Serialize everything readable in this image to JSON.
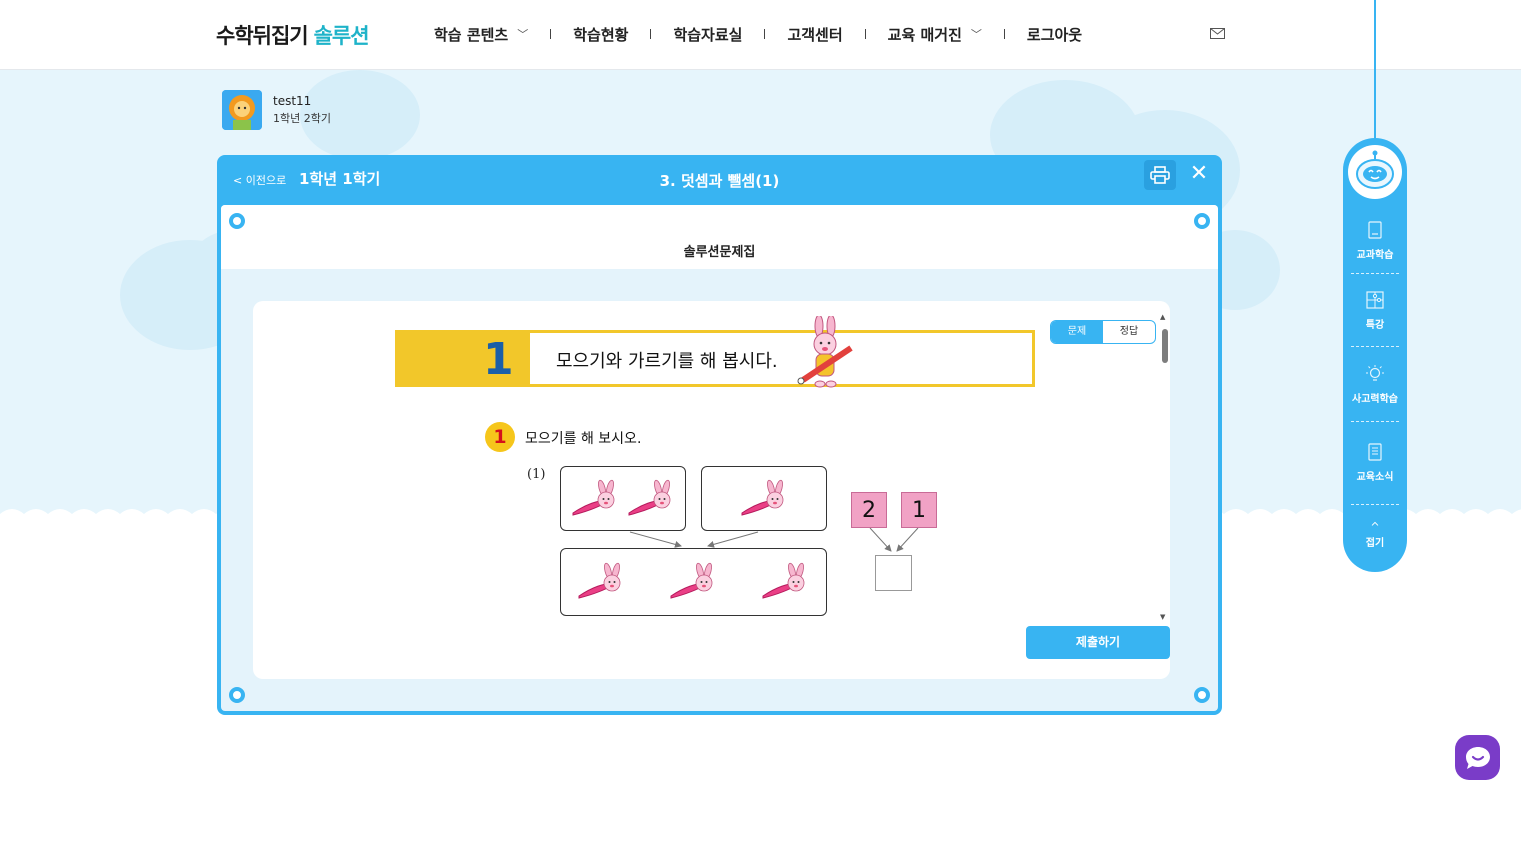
{
  "header": {
    "logo_main": "수학뒤집기",
    "logo_accent": "솔루션",
    "nav": [
      {
        "label": "학습 콘텐츠",
        "has_dropdown": true
      },
      {
        "label": "학습현황",
        "has_dropdown": false
      },
      {
        "label": "학습자료실",
        "has_dropdown": false
      },
      {
        "label": "고객센터",
        "has_dropdown": false
      },
      {
        "label": "교육 매거진",
        "has_dropdown": true
      },
      {
        "label": "로그아웃",
        "has_dropdown": false
      }
    ],
    "mail_icon": "mail-icon"
  },
  "user": {
    "name": "test11",
    "grade": "1학년 2학기",
    "avatar_icon": "lion-avatar"
  },
  "panel": {
    "back_label": "< 이전으로",
    "grade_label": "1학년 1학기",
    "title": "3. 덧셈과 뺄셈(1)",
    "print_icon": "printer-icon",
    "close_label": "✕",
    "inner_title": "솔루션문제집"
  },
  "worksheet": {
    "toggle": {
      "problem": "문제",
      "answer": "정답",
      "active": "problem"
    },
    "banner_number": "1",
    "banner_text": "모으기와 가르기를 해 봅시다.",
    "question_number": "1",
    "question_text": "모으기를 해 보시오.",
    "sub_label": "(1)",
    "left_group_count": 2,
    "right_group_count": 1,
    "total_count": 3,
    "num_left": "2",
    "num_right": "1",
    "submit_label": "제출하기"
  },
  "sidebar": {
    "robot_icon": "robot-icon",
    "items": [
      {
        "label": "교과학습",
        "icon": "book-icon"
      },
      {
        "label": "특강",
        "icon": "puzzle-icon"
      },
      {
        "label": "사고력학습",
        "icon": "bulb-icon"
      },
      {
        "label": "교육소식",
        "icon": "news-icon"
      }
    ],
    "fold_label": "접기"
  },
  "colors": {
    "primary": "#38b4f2",
    "banner_yellow": "#f2c72a",
    "pink_box": "#f1a2c5",
    "chat": "#7a3cc8"
  }
}
